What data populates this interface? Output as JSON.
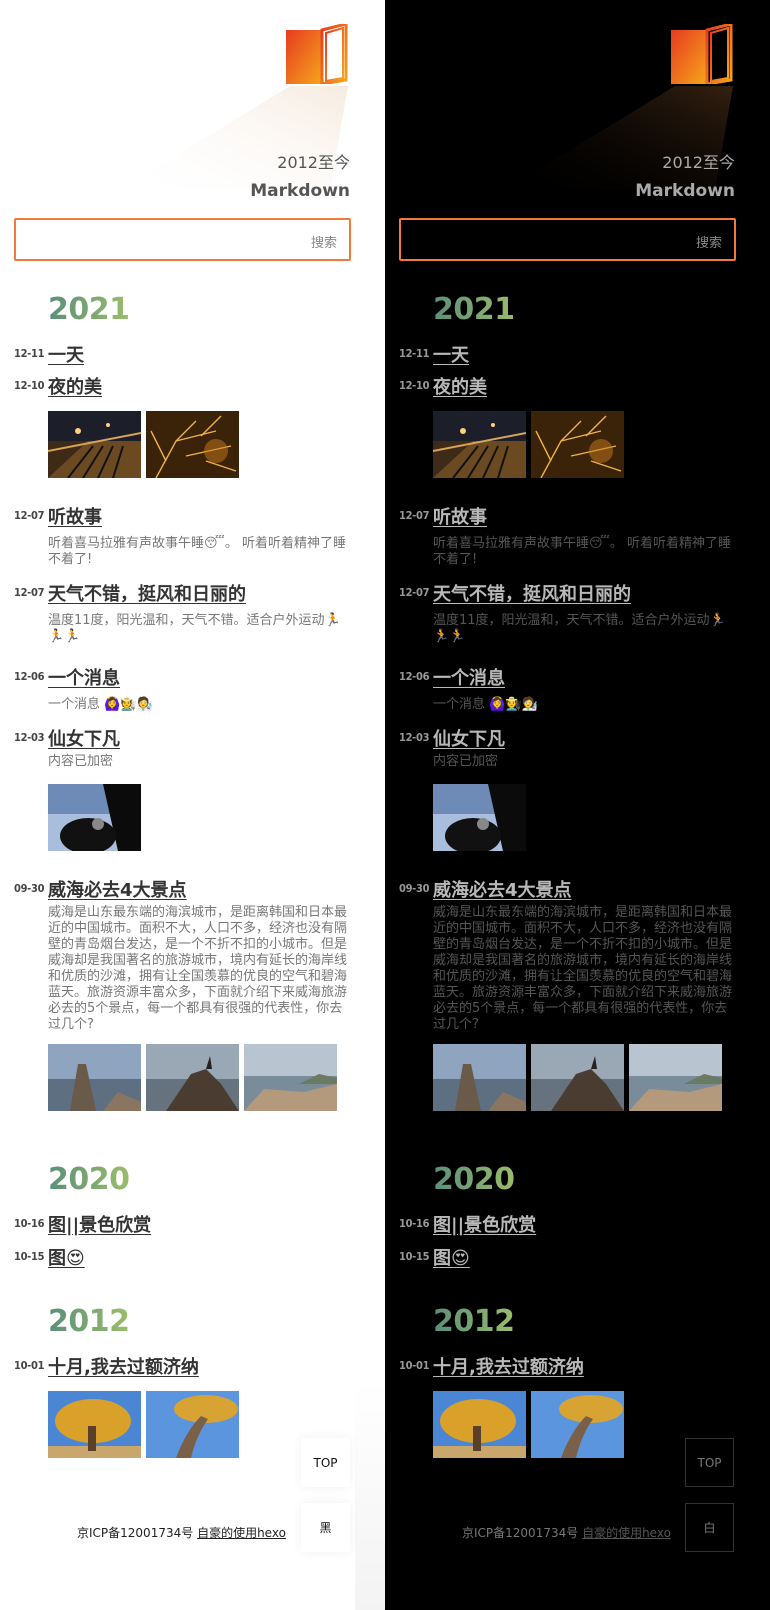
{
  "header": {
    "tagline_years": "2012至今",
    "tagline_sub": "Markdown"
  },
  "search": {
    "placeholder": "",
    "button_label": "搜索"
  },
  "years": [
    {
      "year": "2021",
      "posts": [
        {
          "date": "12-11",
          "title": "一天"
        },
        {
          "date": "12-10",
          "title": "夜的美"
        },
        {
          "date": "12-07",
          "title": "听故事",
          "excerpt": "听着喜马拉雅有声故事午睡😴。 听着听着精神了睡不着了!"
        },
        {
          "date": "12-07",
          "title": "天气不错，挺风和日丽的",
          "excerpt": "温度11度，阳光温和，天气不错。适合户外运动🏃🏃🏃"
        },
        {
          "date": "12-06",
          "title": "一个消息",
          "excerpt": "一个消息 🙆‍♀️🧑‍🌾🧑‍🔬"
        },
        {
          "date": "12-03",
          "title": "仙女下凡",
          "excerpt": "内容已加密"
        },
        {
          "date": "09-30",
          "title": "威海必去4大景点",
          "excerpt": "威海是山东最东端的海滨城市，是距离韩国和日本最近的中国城市。面积不大，人口不多，经济也没有隔壁的青岛烟台发达，是一个不折不扣的小城市。但是威海却是我国著名的旅游城市，境内有延长的海岸线和优质的沙滩，拥有让全国羡慕的优良的空气和碧海蓝天。旅游资源丰富众多，下面就介绍下来威海旅游必去的5个景点，每一个都具有很强的代表性，你去过几个?"
        }
      ]
    },
    {
      "year": "2020",
      "posts": [
        {
          "date": "10-16",
          "title": "图||景色欣赏"
        },
        {
          "date": "10-15",
          "title": "图😍"
        }
      ]
    },
    {
      "year": "2012",
      "posts": [
        {
          "date": "10-01",
          "title": "十月,我去过额济纳"
        }
      ]
    }
  ],
  "footer": {
    "icp": "京ICP备12001734号",
    "link": "自豪的使用hexo"
  },
  "buttons": {
    "top": "TOP",
    "theme_dark": "黑",
    "theme_light": "白"
  },
  "colors": {
    "accent": "#f07a3a",
    "year_start": "#5a8f7a",
    "year_end": "#9bbd6a"
  }
}
